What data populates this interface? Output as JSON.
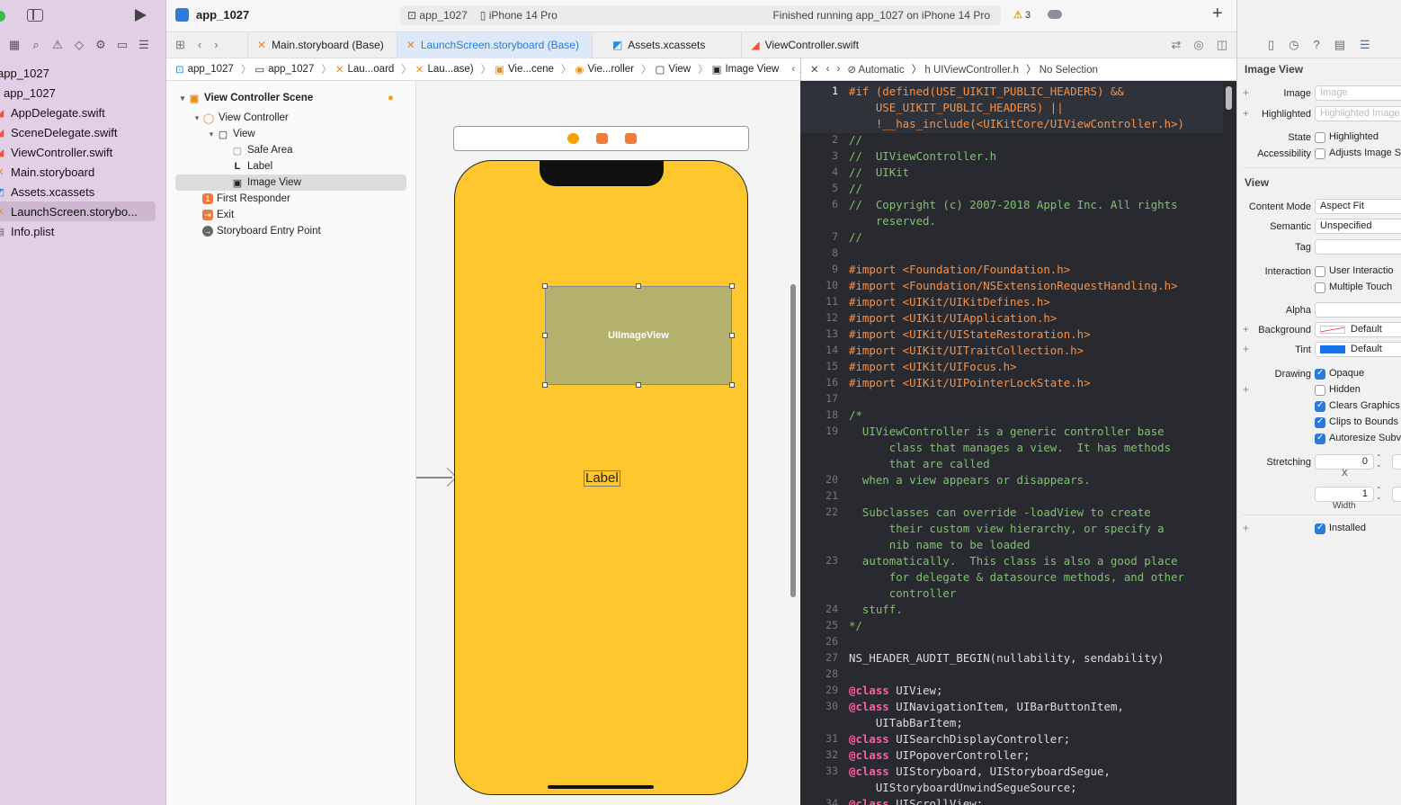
{
  "navigator": {
    "project": "app_1027",
    "files": [
      {
        "name": "app_1027",
        "kind": "group"
      },
      {
        "name": "AppDelegate.swift",
        "kind": "swift"
      },
      {
        "name": "SceneDelegate.swift",
        "kind": "swift"
      },
      {
        "name": "ViewController.swift",
        "kind": "swift"
      },
      {
        "name": "Main.storyboard",
        "kind": "storyboard"
      },
      {
        "name": "Assets.xcassets",
        "kind": "assets"
      },
      {
        "name": "LaunchScreen.storybo...",
        "kind": "storyboard"
      },
      {
        "name": "Info.plist",
        "kind": "plist"
      }
    ]
  },
  "header": {
    "title": "app_1027",
    "scheme": "app_1027",
    "device": "iPhone 14 Pro",
    "status": "Finished running app_1027 on iPhone 14 Pro",
    "warnings": "3"
  },
  "tabs": [
    {
      "label": "Main.storyboard (Base)"
    },
    {
      "label": "LaunchScreen.storyboard (Base)"
    },
    {
      "label": "Assets.xcassets"
    },
    {
      "label": "ViewController.swift"
    }
  ],
  "breadcrumb": [
    "app_1027",
    "app_1027",
    "Lau...oard",
    "Lau...ase)",
    "Vie...cene",
    "Vie...roller",
    "View",
    "Image View"
  ],
  "outline": [
    {
      "label": "View Controller Scene",
      "level": 0
    },
    {
      "label": "View Controller",
      "level": 1
    },
    {
      "label": "View",
      "level": 2
    },
    {
      "label": "Safe Area",
      "level": 3
    },
    {
      "label": "Label",
      "level": 3
    },
    {
      "label": "Image View",
      "level": 3
    },
    {
      "label": "First Responder",
      "level": 1
    },
    {
      "label": "Exit",
      "level": 1
    },
    {
      "label": "Storyboard Entry Point",
      "level": 1
    }
  ],
  "canvas": {
    "image_view_text": "UIImageView",
    "label_text": "Label"
  },
  "code_breadcrumb": {
    "mode": "Automatic",
    "file": "UIViewController.h",
    "selection": "No Selection"
  },
  "code": [
    {
      "n": "1",
      "t": "#if (defined(USE_UIKIT_PUBLIC_HEADERS) &&",
      "c": "pp"
    },
    {
      "n": "",
      "t": "    USE_UIKIT_PUBLIC_HEADERS) ||",
      "c": "pp"
    },
    {
      "n": "",
      "t": "    !__has_include(<UIKitCore/UIViewController.h>)",
      "c": "pp"
    },
    {
      "n": "2",
      "t": "//",
      "c": "cm"
    },
    {
      "n": "3",
      "t": "//  UIViewController.h",
      "c": "cm"
    },
    {
      "n": "4",
      "t": "//  UIKit",
      "c": "cm"
    },
    {
      "n": "5",
      "t": "//",
      "c": "cm"
    },
    {
      "n": "6",
      "t": "//  Copyright (c) 2007-2018 Apple Inc. All rights",
      "c": "cm"
    },
    {
      "n": "",
      "t": "    reserved.",
      "c": "cm"
    },
    {
      "n": "7",
      "t": "//",
      "c": "cm"
    },
    {
      "n": "8",
      "t": "",
      "c": ""
    },
    {
      "n": "9",
      "t": "#import <Foundation/Foundation.h>",
      "c": "pp"
    },
    {
      "n": "10",
      "t": "#import <Foundation/NSExtensionRequestHandling.h>",
      "c": "pp"
    },
    {
      "n": "11",
      "t": "#import <UIKit/UIKitDefines.h>",
      "c": "pp"
    },
    {
      "n": "12",
      "t": "#import <UIKit/UIApplication.h>",
      "c": "pp"
    },
    {
      "n": "13",
      "t": "#import <UIKit/UIStateRestoration.h>",
      "c": "pp"
    },
    {
      "n": "14",
      "t": "#import <UIKit/UITraitCollection.h>",
      "c": "pp"
    },
    {
      "n": "15",
      "t": "#import <UIKit/UIFocus.h>",
      "c": "pp"
    },
    {
      "n": "16",
      "t": "#import <UIKit/UIPointerLockState.h>",
      "c": "pp"
    },
    {
      "n": "17",
      "t": "",
      "c": ""
    },
    {
      "n": "18",
      "t": "/*",
      "c": "cm"
    },
    {
      "n": "19",
      "t": "  UIViewController is a generic controller base",
      "c": "cm"
    },
    {
      "n": "",
      "t": "      class that manages a view.  It has methods",
      "c": "cm"
    },
    {
      "n": "",
      "t": "      that are called",
      "c": "cm"
    },
    {
      "n": "20",
      "t": "  when a view appears or disappears.",
      "c": "cm"
    },
    {
      "n": "21",
      "t": "",
      "c": ""
    },
    {
      "n": "22",
      "t": "  Subclasses can override -loadView to create",
      "c": "cm"
    },
    {
      "n": "",
      "t": "      their custom view hierarchy, or specify a",
      "c": "cm"
    },
    {
      "n": "",
      "t": "      nib name to be loaded",
      "c": "cm"
    },
    {
      "n": "23",
      "t": "  automatically.  This class is also a good place",
      "c": "cm"
    },
    {
      "n": "",
      "t": "      for delegate & datasource methods, and other",
      "c": "cm"
    },
    {
      "n": "",
      "t": "      controller",
      "c": "cm"
    },
    {
      "n": "24",
      "t": "  stuff.",
      "c": "cm"
    },
    {
      "n": "25",
      "t": "*/",
      "c": "cm"
    },
    {
      "n": "26",
      "t": "",
      "c": ""
    },
    {
      "n": "27",
      "t": "NS_HEADER_AUDIT_BEGIN(nullability, sendability)",
      "c": "pl"
    },
    {
      "n": "28",
      "t": "",
      "c": ""
    },
    {
      "n": "29",
      "t": "@class UIView;",
      "c": "kwl"
    },
    {
      "n": "30",
      "t": "@class UINavigationItem, UIBarButtonItem,",
      "c": "kwl"
    },
    {
      "n": "",
      "t": "    UITabBarItem;",
      "c": "pl"
    },
    {
      "n": "31",
      "t": "@class UISearchDisplayController;",
      "c": "kwl"
    },
    {
      "n": "32",
      "t": "@class UIPopoverController;",
      "c": "kwl"
    },
    {
      "n": "33",
      "t": "@class UIStoryboard, UIStoryboardSegue,",
      "c": "kwl"
    },
    {
      "n": "",
      "t": "    UIStoryboardUnwindSegueSource;",
      "c": "pl"
    },
    {
      "n": "34",
      "t": "@class UIScrollView;",
      "c": "kwl"
    }
  ],
  "inspector": {
    "image_section": "Image View",
    "image_label": "Image",
    "image_placeholder": "Image",
    "highlighted_label": "Highlighted",
    "highlighted_placeholder": "Highlighted Image",
    "state_label": "State",
    "state_value": "Highlighted",
    "accessibility_label": "Accessibility",
    "accessibility_value": "Adjusts Image S",
    "view_section": "View",
    "content_mode_label": "Content Mode",
    "content_mode": "Aspect Fit",
    "semantic_label": "Semantic",
    "semantic": "Unspecified",
    "tag_label": "Tag",
    "interaction_label": "Interaction",
    "user_interaction": "User Interactio",
    "multiple_touch": "Multiple Touch",
    "alpha_label": "Alpha",
    "background_label": "Background",
    "background": "Default",
    "tint_label": "Tint",
    "tint": "Default",
    "drawing_label": "Drawing",
    "opaque": "Opaque",
    "hidden": "Hidden",
    "clears_graphics": "Clears Graphics",
    "clips_to_bounds": "Clips to Bounds",
    "autoresize": "Autoresize Subv",
    "stretching_label": "Stretching",
    "stretch_x": "0",
    "x_label": "X",
    "stretch_w": "1",
    "width_label": "Width",
    "installed": "Installed"
  }
}
